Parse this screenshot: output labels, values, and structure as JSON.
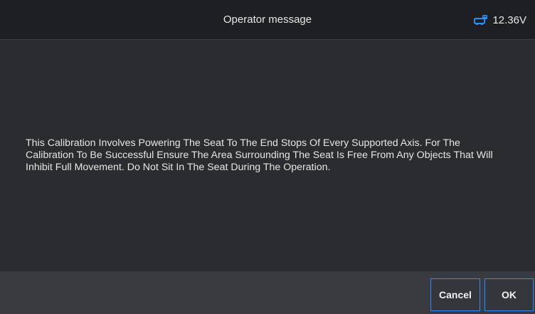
{
  "header": {
    "title": "Operator message",
    "voltage": "12.36V",
    "vci_icon": "vehicle-connector-icon",
    "accent_color": "#2f8cf0"
  },
  "main": {
    "message": "This Calibration Involves Powering The Seat To The End Stops Of Every Supported Axis. For The Calibration To Be Successful Ensure The Area Surrounding The Seat Is Free From Any Objects That Will Inhibit Full Movement. Do Not Sit In The Seat During The Operation."
  },
  "footer": {
    "cancel_label": "Cancel",
    "ok_label": "OK"
  }
}
